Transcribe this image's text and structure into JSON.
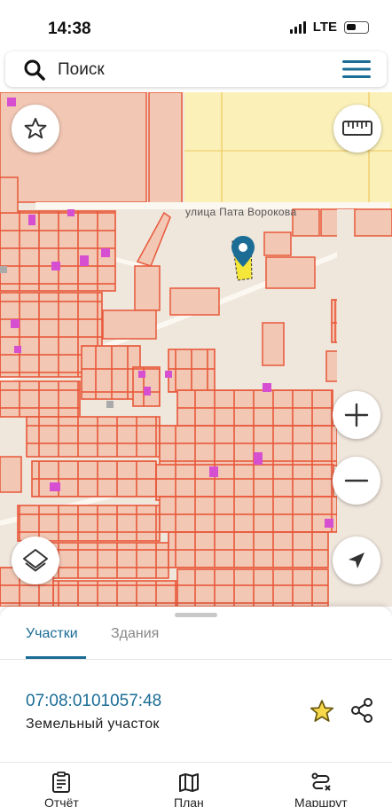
{
  "status_bar": {
    "time": "14:38",
    "network": "LTE"
  },
  "search": {
    "label": "Поиск"
  },
  "map": {
    "street_label": "улица Пата Ворокова",
    "parcel_fill_color": "#f2c7b4",
    "parcel_border_color": "#e8583a",
    "building_color": "#d64fd0",
    "marker_color": "#1b6d96",
    "selected_parcel_color": "#f5e63a"
  },
  "sheet": {
    "tabs": [
      {
        "label": "Участки",
        "active": true
      },
      {
        "label": "Здания",
        "active": false
      }
    ],
    "parcel": {
      "number": "07:08:0101057:48",
      "type": "Земельный участок"
    }
  },
  "bottom_nav": [
    {
      "label": "Отчёт",
      "icon": "report-icon"
    },
    {
      "label": "План",
      "icon": "map-plan-icon"
    },
    {
      "label": "Маршрут",
      "icon": "route-icon"
    }
  ],
  "accent_color": "#1b6d96"
}
